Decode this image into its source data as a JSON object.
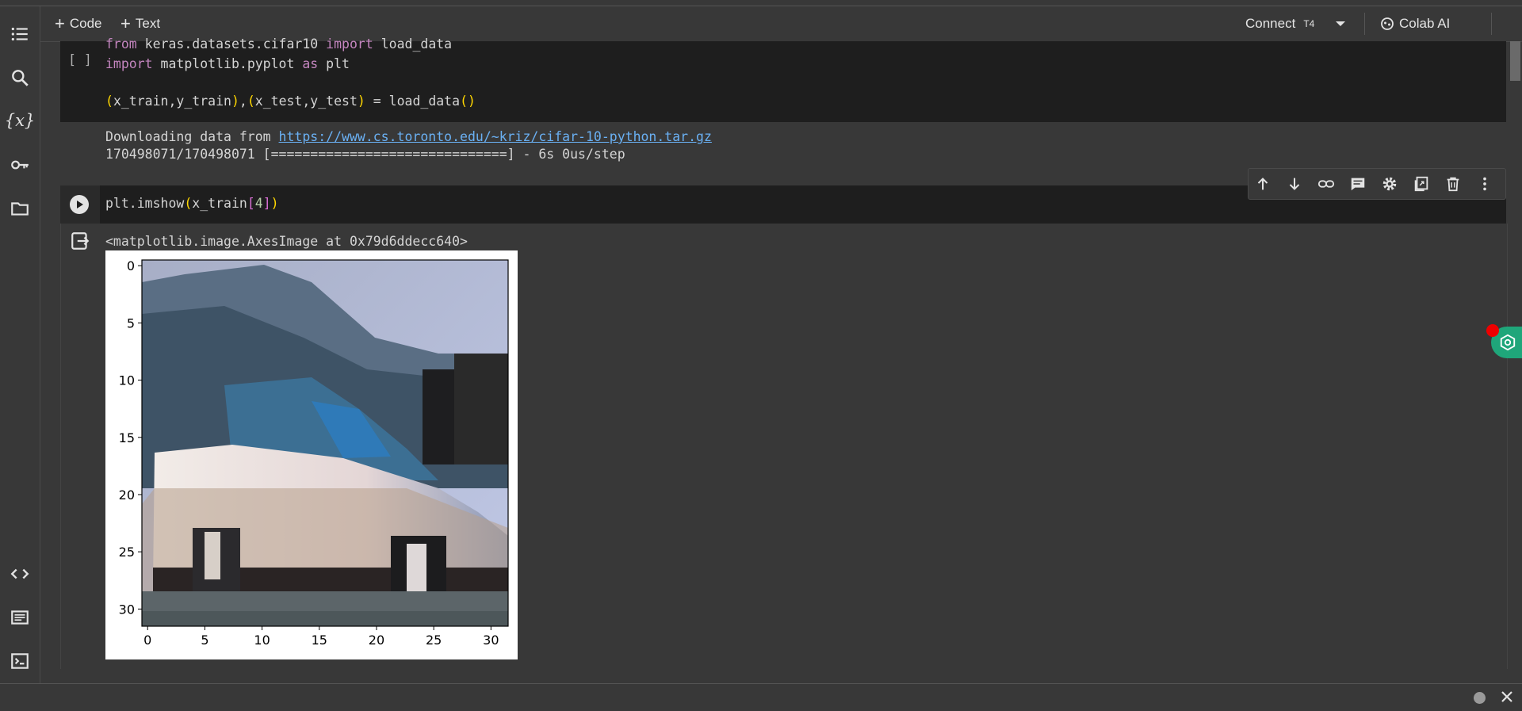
{
  "toolbar": {
    "code_label": "Code",
    "text_label": "Text",
    "connect_label": "Connect",
    "runtime_label": "T4",
    "colab_ai_label": "Colab AI"
  },
  "rail": {
    "icons": [
      "toc-icon",
      "search-icon",
      "variables-icon",
      "secrets-icon",
      "files-icon",
      "code-snippets-icon",
      "command-palette-icon",
      "terminal-icon"
    ]
  },
  "cell1": {
    "run_indicator": "[ ]",
    "line1": "from keras.datasets.cifar10 import load_data",
    "line2": "import matplotlib.pyplot as plt",
    "line3": "(x_train,y_train),(x_test,y_test) = load_data()",
    "out_line1_prefix": "Downloading data from ",
    "out_line1_link": "https://www.cs.toronto.edu/~kriz/cifar-10-python.tar.gz",
    "out_line2": "170498071/170498071 [==============================] - 6s 0us/step"
  },
  "cell2": {
    "code": "plt.imshow(x_train[4])",
    "output_text": "<matplotlib.image.AxesImage at 0x79d6ddecc640>"
  },
  "cell_tools": [
    "arrow-up-icon",
    "arrow-down-icon",
    "link-icon",
    "comment-icon",
    "settings-icon",
    "mirror-cell-icon",
    "delete-icon",
    "more-vert-icon"
  ],
  "chart_data": {
    "type": "heatmap",
    "description_image": "32x32 RGB CIFAR-10 image (car)",
    "xticks": [
      "0",
      "5",
      "10",
      "15",
      "20",
      "25",
      "30"
    ],
    "yticks": [
      "0",
      "5",
      "10",
      "15",
      "20",
      "25",
      "30"
    ],
    "xlim": [
      -0.5,
      31.5
    ],
    "ylim": [
      31.5,
      -0.5
    ]
  },
  "colors": {
    "background": "#383838",
    "cell": "#1e1e1e",
    "keyword": "#c586c0",
    "link": "#6ab0f3",
    "accent_green": "#1fa67a"
  }
}
